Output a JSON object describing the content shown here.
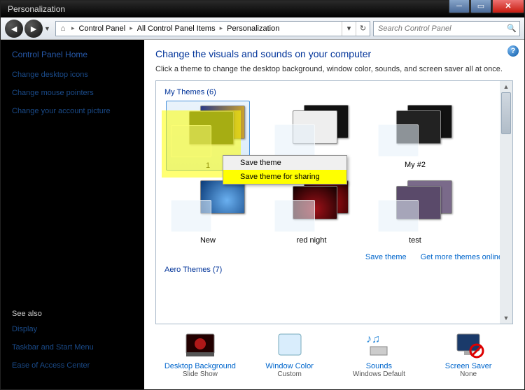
{
  "title": "Personalization",
  "breadcrumb": [
    "Control Panel",
    "All Control Panel Items",
    "Personalization"
  ],
  "search_placeholder": "Search Control Panel",
  "sidebar": {
    "home": "Control Panel Home",
    "links": [
      "Change desktop icons",
      "Change mouse pointers",
      "Change your account picture"
    ],
    "see_also_label": "See also",
    "see_also": [
      "Display",
      "Taskbar and Start Menu",
      "Ease of Access Center"
    ]
  },
  "heading": "Change the visuals and sounds on your computer",
  "subtext": "Click a theme to change the desktop background, window color, sounds, and screen saver all at once.",
  "sections": {
    "my_themes": {
      "title": "My Themes (6)",
      "items": [
        "1",
        "",
        "My #2",
        "New",
        "red night",
        "test"
      ]
    },
    "aero_themes": {
      "title": "Aero Themes (7)"
    }
  },
  "links": {
    "save": "Save theme",
    "more": "Get more themes online"
  },
  "context_menu": {
    "items": [
      "Save theme",
      "Save theme for sharing"
    ],
    "highlight": 1
  },
  "bottom": [
    {
      "label": "Desktop Background",
      "value": "Slide Show"
    },
    {
      "label": "Window Color",
      "value": "Custom"
    },
    {
      "label": "Sounds",
      "value": "Windows Default"
    },
    {
      "label": "Screen Saver",
      "value": "None"
    }
  ]
}
